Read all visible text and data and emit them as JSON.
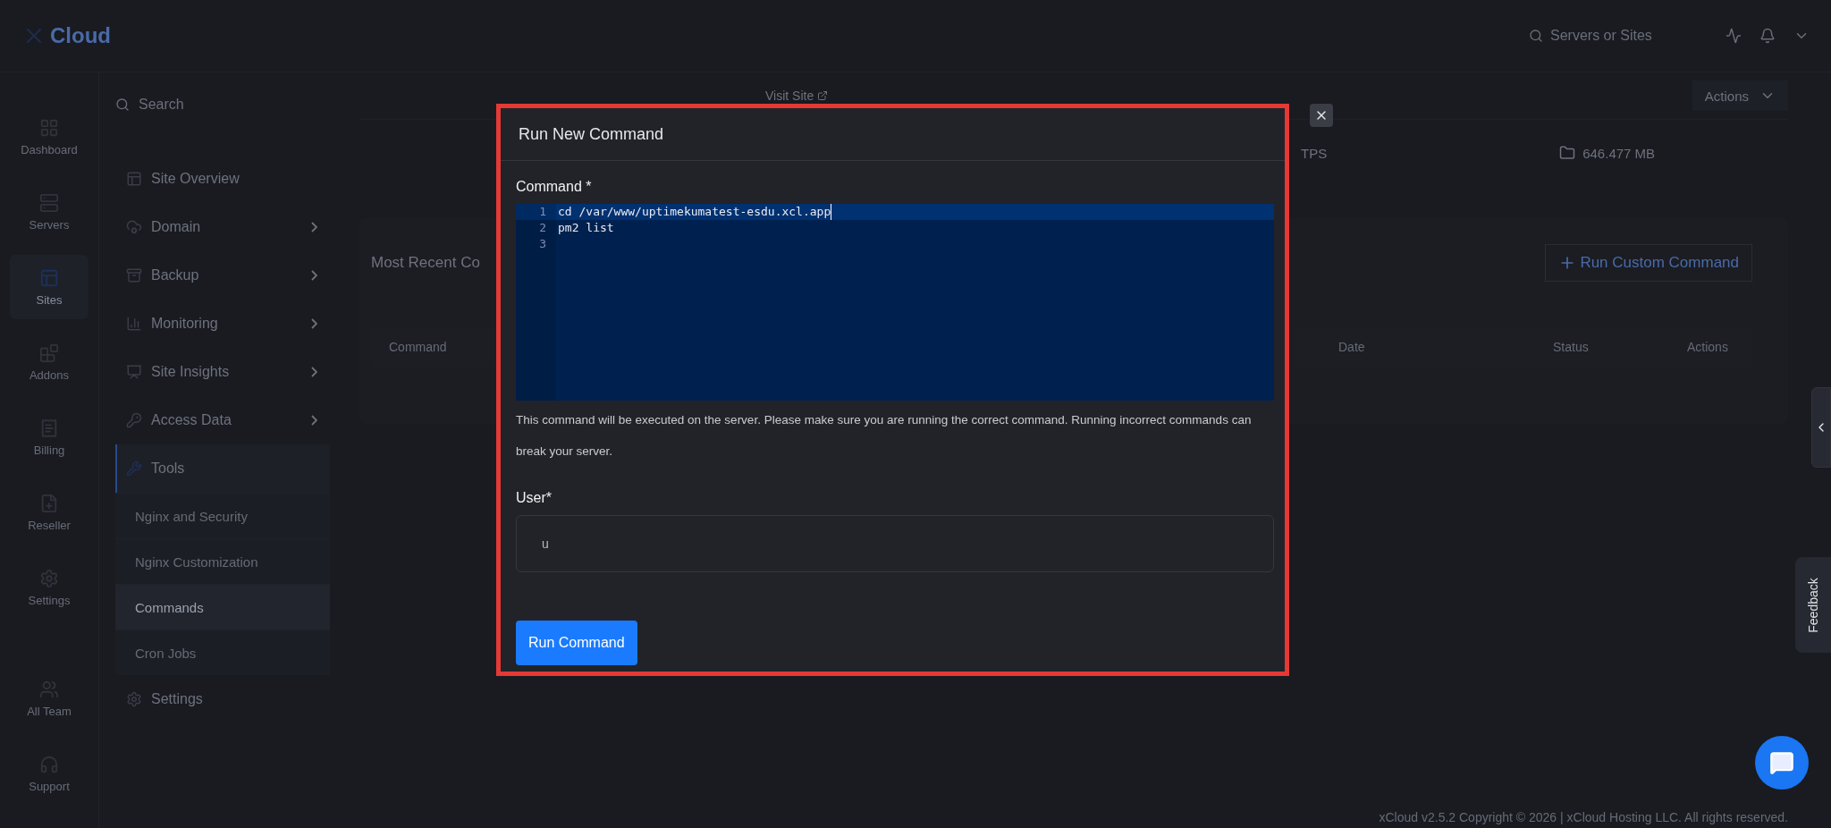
{
  "topbar": {
    "logo": "Cloud",
    "search": {
      "placeholder": "Servers or Sites"
    }
  },
  "rail": [
    {
      "label": "Dashboard",
      "selected": false
    },
    {
      "label": "Servers",
      "selected": false
    },
    {
      "label": "Sites",
      "selected": true
    },
    {
      "label": "Addons",
      "selected": false
    },
    {
      "label": "Billing",
      "selected": false
    },
    {
      "label": "Reseller",
      "selected": false
    },
    {
      "label": "Settings",
      "selected": false
    },
    {
      "label": "All Team",
      "selected": false
    },
    {
      "label": "Support",
      "selected": false
    }
  ],
  "sidebar": {
    "search": {
      "placeholder": "Search"
    },
    "items": [
      {
        "label": "Site Overview",
        "chevron": false,
        "expanded": false
      },
      {
        "label": "Domain",
        "chevron": true,
        "expanded": false
      },
      {
        "label": "Backup",
        "chevron": true,
        "expanded": false
      },
      {
        "label": "Monitoring",
        "chevron": true,
        "expanded": false
      },
      {
        "label": "Site Insights",
        "chevron": true,
        "expanded": false
      },
      {
        "label": "Access Data",
        "chevron": true,
        "expanded": false
      },
      {
        "label": "Tools",
        "chevron": false,
        "expanded": true,
        "children": [
          {
            "label": "Nginx and Security",
            "selected": false
          },
          {
            "label": "Nginx Customization",
            "selected": false
          },
          {
            "label": "Commands",
            "selected": true
          },
          {
            "label": "Cron Jobs",
            "selected": false
          }
        ]
      },
      {
        "label": "Settings",
        "chevron": false,
        "expanded": false
      }
    ]
  },
  "header": {
    "link": "Visit Site",
    "actions": "Actions"
  },
  "stats": {
    "protocol": "TPS",
    "disk": "646.477 MB"
  },
  "card": {
    "title": "Most Recent Co",
    "button": "Run Custom Command",
    "columns": [
      "Command",
      "Date",
      "Status",
      "Actions"
    ]
  },
  "modal": {
    "title": "Run New Command",
    "command_label": "Command *",
    "lines": [
      {
        "number": "1",
        "text": "cd /var/www/uptimekumatest-esdu.xcl.app",
        "active": true
      },
      {
        "number": "2",
        "text": "pm2 list",
        "active": false
      },
      {
        "number": "3",
        "active": false
      }
    ],
    "help": "This command will be executed on the server. Please make sure you are running the correct command. Running incorrect commands can break your server.",
    "user_label": "User*",
    "user_value": "u",
    "button": "Run Command"
  },
  "feedback": "Feedback",
  "footer": "xCloud v2.5.2 Copyright © 2026 | xCloud Hosting LLC. All rights reserved."
}
